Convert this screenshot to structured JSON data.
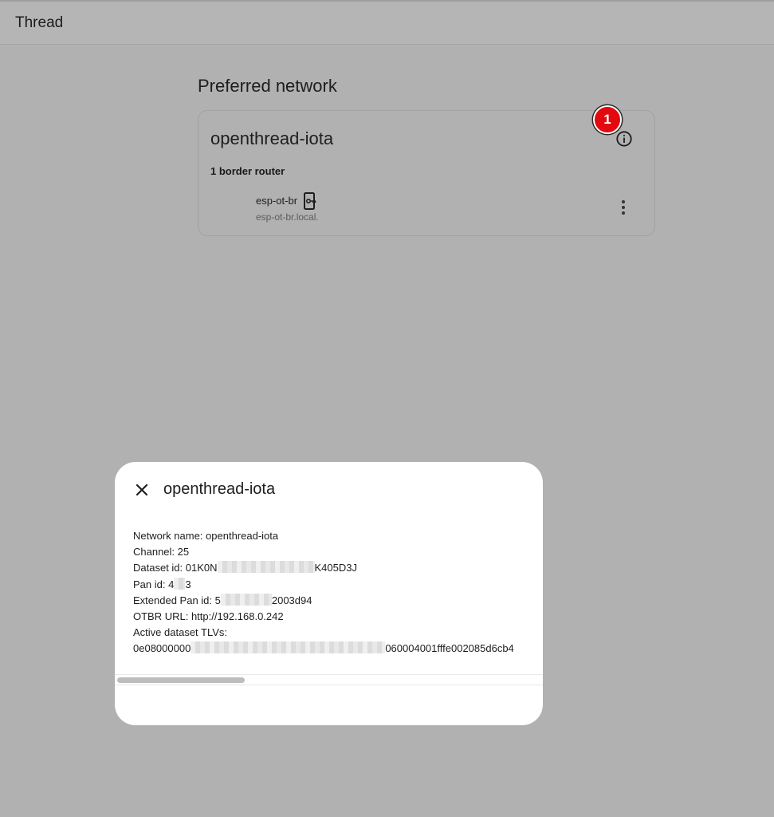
{
  "topbar": {
    "title": "Thread"
  },
  "preferred": {
    "section_title": "Preferred network",
    "network_name": "openthread-iota",
    "badge": "1",
    "border_router_count": "1 border router",
    "router": {
      "name": "esp-ot-br",
      "host": "esp-ot-br.local."
    }
  },
  "dialog": {
    "title": "openthread-iota",
    "network_name_line": "Network name: openthread-iota",
    "channel_line": "Channel: 25",
    "dataset_prefix": "Dataset id: 01K0N",
    "dataset_suffix": "K405D3J",
    "pan_prefix": "Pan id: 4",
    "pan_suffix": "3",
    "ext_pan_prefix": "Extended Pan id: 5",
    "ext_pan_suffix": "2003d94",
    "otbr_line": "OTBR URL: http://192.168.0.242",
    "tlv_label": "Active dataset TLVs:",
    "tlv_prefix": "0e08000000",
    "tlv_suffix": "060004001fffe002085d6cb4"
  },
  "colors": {
    "badge": "#e4080f",
    "backdrop": "#b1b1b1",
    "dialog": "#ffffff"
  }
}
